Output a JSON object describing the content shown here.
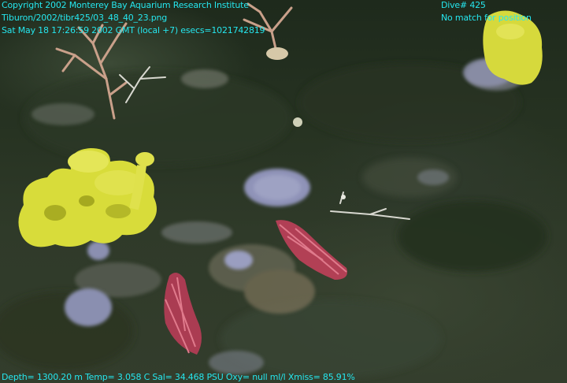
{
  "overlay": {
    "top_left": [
      "Copyright 2002 Monterey Bay Aquarium Research Institute",
      "Tiburon/2002/tibr425/03_48_40_23.png",
      "Sat May 18 17:26:59 2002 GMT (local +7)  esecs=1021742819"
    ],
    "top_right": [
      "Dive# 425",
      "No match for position"
    ],
    "bottom": "Depth= 1300.20 m  Temp= 3.058 C  Sal= 34.468 PSU  Oxy= null ml/l  Xmiss= 85.91%"
  },
  "colors": {
    "overlay_text": "#25e6ee",
    "seafloor": "#2f3a29",
    "yellow_sponge": "#d8dc3a",
    "red_coral": "#c0405a",
    "pale_coral": "#c9a08a",
    "lavender_sponge": "#8f93b8"
  }
}
